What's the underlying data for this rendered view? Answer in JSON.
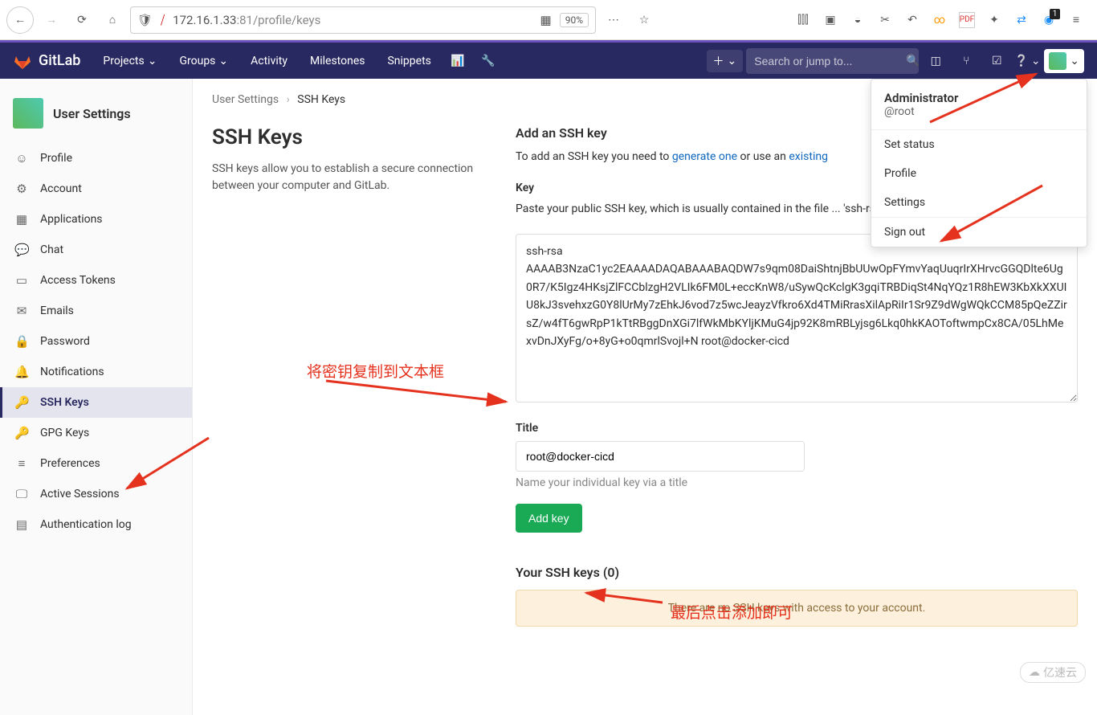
{
  "browser": {
    "url_scheme": "",
    "url_host": "172.16.1.33",
    "url_port": ":81",
    "url_path": "/profile/keys",
    "zoom": "90%",
    "ext_badge": "1"
  },
  "nav": {
    "brand": "GitLab",
    "items": [
      "Projects",
      "Groups",
      "Activity",
      "Milestones",
      "Snippets"
    ],
    "search_placeholder": "Search or jump to..."
  },
  "sidebar": {
    "title": "User Settings",
    "items": [
      {
        "icon": "☺",
        "label": "Profile"
      },
      {
        "icon": "⚙",
        "label": "Account"
      },
      {
        "icon": "▦",
        "label": "Applications"
      },
      {
        "icon": "💬",
        "label": "Chat"
      },
      {
        "icon": "▭",
        "label": "Access Tokens"
      },
      {
        "icon": "✉",
        "label": "Emails"
      },
      {
        "icon": "🔒",
        "label": "Password"
      },
      {
        "icon": "🔔",
        "label": "Notifications"
      },
      {
        "icon": "🔑",
        "label": "SSH Keys"
      },
      {
        "icon": "🔑",
        "label": "GPG Keys"
      },
      {
        "icon": "≡",
        "label": "Preferences"
      },
      {
        "icon": "🖵",
        "label": "Active Sessions"
      },
      {
        "icon": "▤",
        "label": "Authentication log"
      }
    ],
    "active_index": 8
  },
  "breadcrumb": {
    "root": "User Settings",
    "current": "SSH Keys"
  },
  "main": {
    "heading": "SSH Keys",
    "description": "SSH keys allow you to establish a secure connection between your computer and GitLab.",
    "add_heading": "Add an SSH key",
    "add_intro_pre": "To add an SSH key you need to ",
    "add_link1": "generate one",
    "add_intro_mid": " or use an ",
    "add_link2": "existing",
    "key_label": "Key",
    "key_help": "Paste your public SSH key, which is usually contained in the file ... 'ssh-rsa'. Don't use your private SSH key.",
    "key_value": "ssh-rsa AAAAB3NzaC1yc2EAAAADAQABAAABAQDW7s9qm08DaiShtnjBbUUwOpFYmvYaqUuqrIrXHrvcGGQDlte6Ug0R7/K5Igz4HKsjZlFCCblzgH2VLIk6FM0L+eccKnW8/uSywQcKclgK3gqiTRBDiqSt4NqYQz1R8hEW3KbXkXXUIU8kJ3svehxzG0Y8lUrMy7zEhkJ6vod7z5wcJeayzVfkro6Xd4TMiRrasXilApRiIr1Sr9Z9dWgWQkCCM85pQeZZirsZ/w4fT6gwRpP1kTtRBggDnXGi7lfWkMbKYljKMuG4jp92K8mRBLyjsg6Lkq0hkKAOToftwmpCx8CA/05LhMexvDnJXyFg/o+8yG+o0qmrlSvojl+N root@docker-cicd",
    "title_label": "Title",
    "title_value": "root@docker-cicd",
    "title_hint": "Name your individual key via a title",
    "add_btn": "Add key",
    "list_heading": "Your SSH keys (0)",
    "empty_msg": "There are no SSH keys with access to your account."
  },
  "user_menu": {
    "name": "Administrator",
    "handle": "@root",
    "items": [
      "Set status",
      "Profile",
      "Settings"
    ],
    "signout": "Sign out"
  },
  "annotations": {
    "a1": "将密钥复制到文本框",
    "a2": "最后点击添加即可"
  },
  "watermark": "亿速云"
}
